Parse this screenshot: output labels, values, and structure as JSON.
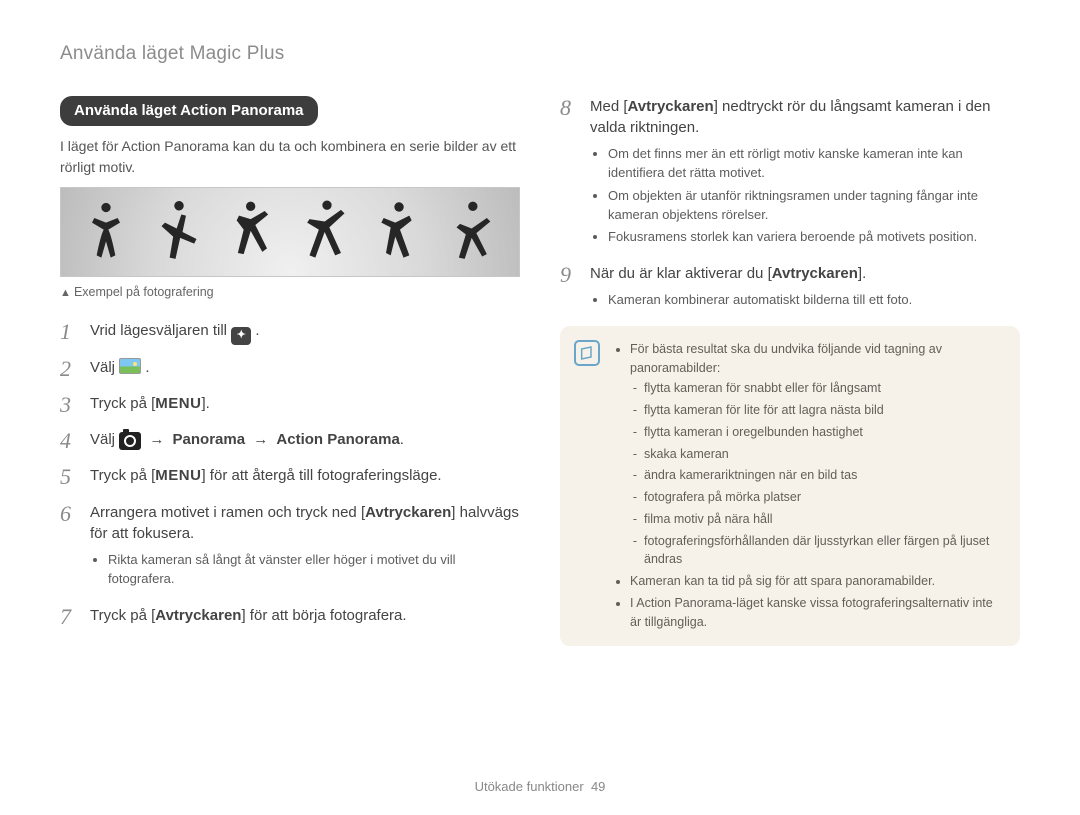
{
  "page_head": "Använda läget Magic Plus",
  "section_title": "Använda läget Action Panorama",
  "section_intro": "I läget för Action Panorama kan du ta och kombinera en serie bilder av ett rörligt motiv.",
  "illustration_caption": "Exempel på fotografering",
  "steps_left": {
    "s1": "Vrid lägesväljaren till ",
    "s2": "Välj ",
    "s3_pre": "Tryck på [",
    "s3_post": "].",
    "s4_pre": "Välj ",
    "s4_mid1": " → ",
    "s4_b1": "Panorama",
    "s4_mid2": " → ",
    "s4_b2": "Action Panorama",
    "s4_post": ".",
    "s5_pre": "Tryck på [",
    "s5_post": "] för att återgå till fotograferingsläge.",
    "s6": "Arrangera motivet i ramen och tryck ned [",
    "s6_b": "Avtryckaren",
    "s6_post": "] halvvägs för att fokusera.",
    "s6_sub": "Rikta kameran så långt åt vänster eller höger i motivet du vill fotografera.",
    "s7_pre": "Tryck på [",
    "s7_b": "Avtryckaren",
    "s7_post": "] för att börja fotografera."
  },
  "steps_right": {
    "s8_pre": "Med [",
    "s8_b": "Avtryckaren",
    "s8_post": "] nedtryckt rör du långsamt kameran i den valda riktningen.",
    "s8_subs": [
      "Om det finns mer än ett rörligt motiv kanske kameran inte kan identifiera det rätta motivet.",
      "Om objekten är utanför riktningsramen under tagning fångar inte kameran objektens rörelser.",
      "Fokusramens storlek kan variera beroende på motivets position."
    ],
    "s9_pre": "När du är klar aktiverar du [",
    "s9_b": "Avtryckaren",
    "s9_post": "].",
    "s9_sub": "Kameran kombinerar automatiskt bilderna till ett foto."
  },
  "notebox": {
    "lead": "För bästa resultat ska du undvika följande vid tagning av panoramabilder:",
    "items": [
      "flytta kameran för snabbt eller för långsamt",
      "flytta kameran för lite för att lagra nästa bild",
      "flytta kameran i oregelbunden hastighet",
      "skaka kameran",
      "ändra kamerariktningen när en bild tas",
      "fotografera på mörka platser",
      "filma motiv på nära håll",
      "fotograferingsförhållanden där ljusstyrkan eller färgen på ljuset ändras"
    ],
    "tail1": "Kameran kan ta tid på sig för att spara panoramabilder.",
    "tail2": "I Action Panorama-läget kanske vissa fotograferingsalternativ inte är tillgängliga."
  },
  "menu_word": "MENU",
  "footer_label": "Utökade funktioner",
  "footer_page": "49"
}
